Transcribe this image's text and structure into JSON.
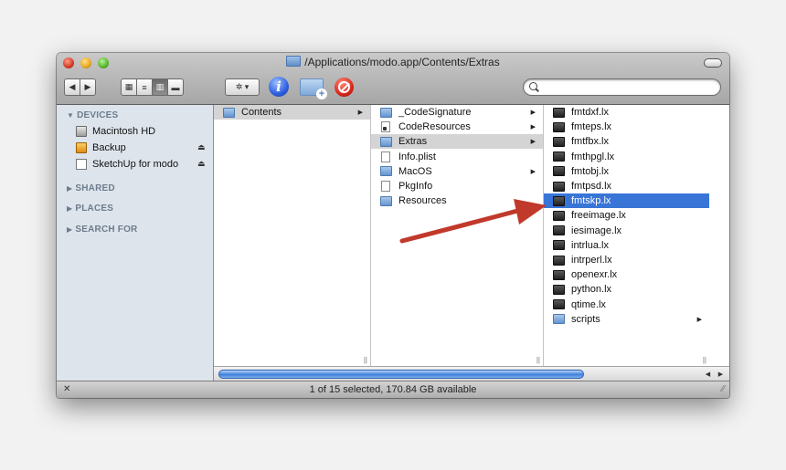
{
  "window": {
    "title": "/Applications/modo.app/Contents/Extras",
    "status": "1 of 15 selected, 170.84 GB available"
  },
  "toolbar": {
    "back": "◀",
    "forward": "▶",
    "view_icon": "▦",
    "view_list": "≡",
    "view_column": "▥",
    "view_coverflow": "▬",
    "action": "✲ ▾",
    "info": "i",
    "new_folder_plus": "+",
    "search_placeholder": ""
  },
  "sidebar": {
    "devices_label": "DEVICES",
    "devices": [
      {
        "label": "Macintosh HD",
        "icon": "hard-drive-icon"
      },
      {
        "label": "Backup",
        "icon": "backup-drive-icon"
      },
      {
        "label": "SketchUp for modo",
        "icon": "disk-image-icon"
      }
    ],
    "eject": "⏏",
    "shared_label": "SHARED",
    "places_label": "PLACES",
    "search_label": "SEARCH FOR",
    "expanded_tri": "▼",
    "collapsed_tri": "▶"
  },
  "columns": {
    "col1": [
      {
        "label": "Contents",
        "type": "folder",
        "selected": "gray",
        "arrow": true
      }
    ],
    "col2": [
      {
        "label": "_CodeSignature",
        "type": "folder",
        "arrow": true
      },
      {
        "label": "CodeResources",
        "type": "exec",
        "arrow": true
      },
      {
        "label": "Extras",
        "type": "folder",
        "selected": "gray",
        "arrow": true
      },
      {
        "label": "Info.plist",
        "type": "doc"
      },
      {
        "label": "MacOS",
        "type": "folder",
        "arrow": true
      },
      {
        "label": "PkgInfo",
        "type": "doc"
      },
      {
        "label": "Resources",
        "type": "folder"
      }
    ],
    "col3": [
      {
        "label": "fmtdxf.lx",
        "type": "lx"
      },
      {
        "label": "fmteps.lx",
        "type": "lx"
      },
      {
        "label": "fmtfbx.lx",
        "type": "lx"
      },
      {
        "label": "fmthpgl.lx",
        "type": "lx"
      },
      {
        "label": "fmtobj.lx",
        "type": "lx"
      },
      {
        "label": "fmtpsd.lx",
        "type": "lx"
      },
      {
        "label": "fmtskp.lx",
        "type": "lx",
        "selected": "blue"
      },
      {
        "label": "freeimage.lx",
        "type": "lx"
      },
      {
        "label": "iesimage.lx",
        "type": "lx"
      },
      {
        "label": "intrlua.lx",
        "type": "lx"
      },
      {
        "label": "intrperl.lx",
        "type": "lx"
      },
      {
        "label": "openexr.lx",
        "type": "lx"
      },
      {
        "label": "python.lx",
        "type": "lx"
      },
      {
        "label": "qtime.lx",
        "type": "lx"
      },
      {
        "label": "scripts",
        "type": "folder",
        "arrow": true
      }
    ],
    "arrow_glyph": "▶",
    "col_grip": "||"
  },
  "scroll": {
    "left_arrow": "◀",
    "right_arrow": "▶"
  },
  "annotation": {
    "color": "#c0392b"
  }
}
